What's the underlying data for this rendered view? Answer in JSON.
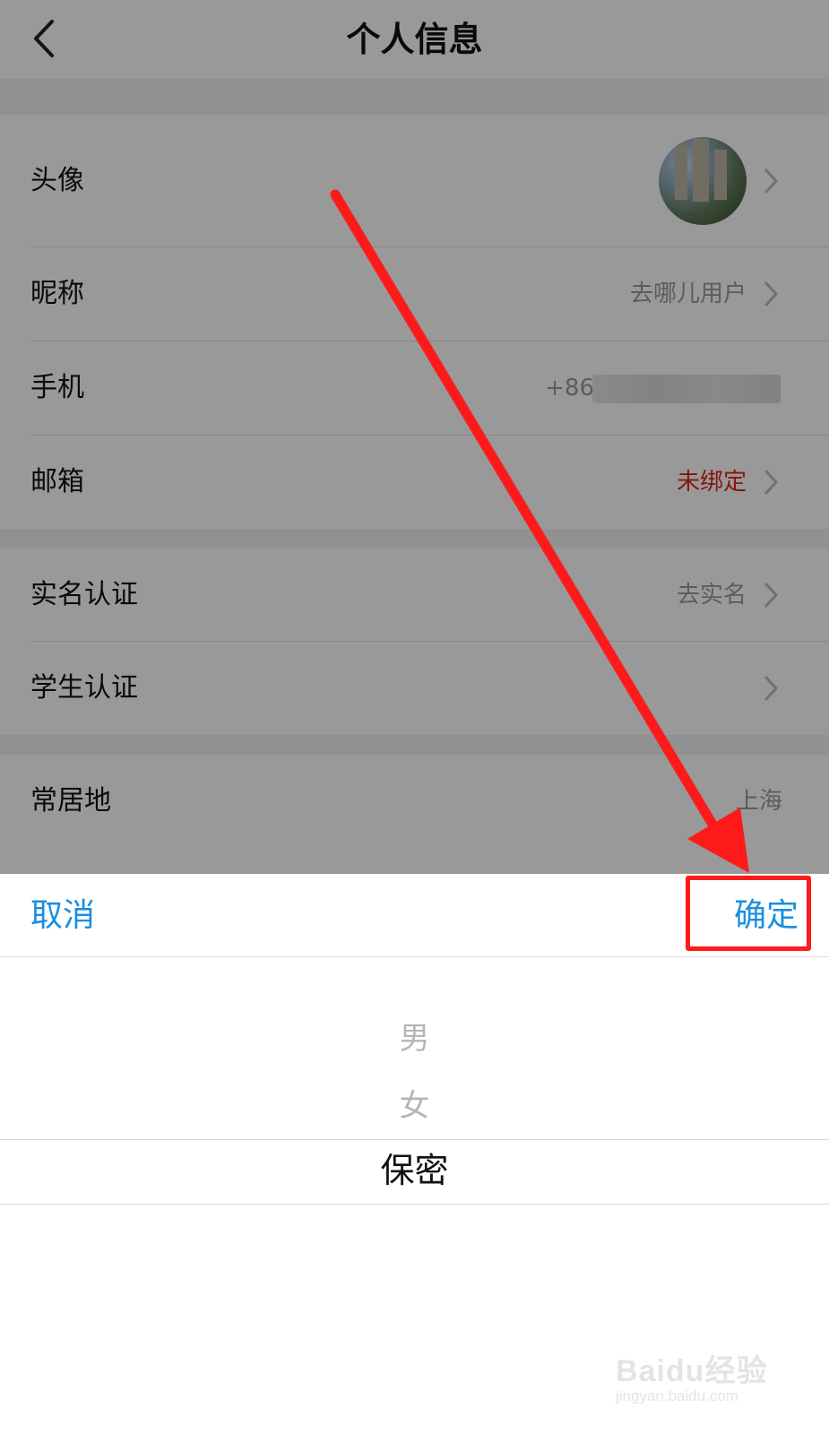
{
  "header": {
    "title": "个人信息"
  },
  "rows": {
    "avatar": {
      "label": "头像"
    },
    "nickname": {
      "label": "昵称",
      "value": "去哪儿用户"
    },
    "phone": {
      "label": "手机",
      "value": "+86"
    },
    "email": {
      "label": "邮箱",
      "value": "未绑定"
    },
    "realname": {
      "label": "实名认证",
      "value": "去实名"
    },
    "student": {
      "label": "学生认证"
    },
    "residence": {
      "label": "常居地",
      "value": "上海"
    }
  },
  "picker": {
    "cancel_label": "取消",
    "confirm_label": "确定",
    "options": [
      "男",
      "女",
      "保密"
    ],
    "selected": "保密"
  },
  "watermark": {
    "brand": "Baidu经验",
    "url": "jingyan.baidu.com"
  },
  "colors": {
    "accent": "#1a8fe0",
    "warning": "#e0251b",
    "annotation": "#ff1a1a"
  }
}
